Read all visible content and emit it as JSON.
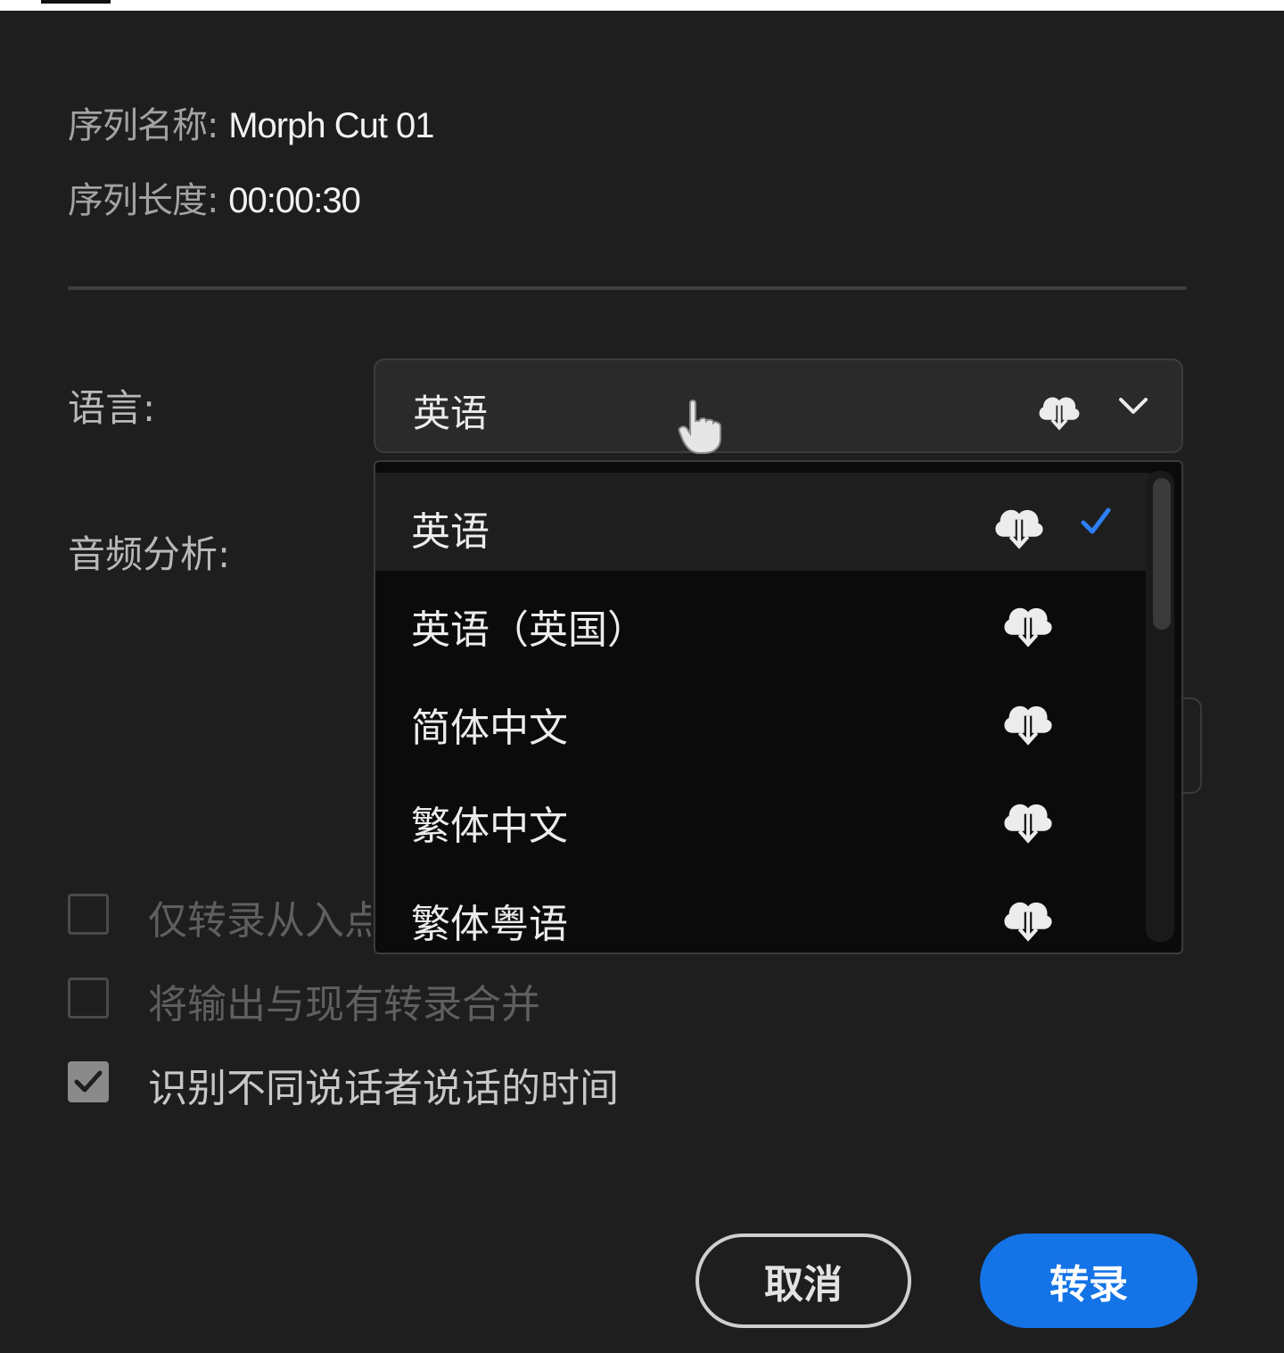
{
  "sequence": {
    "name_label": "序列名称:",
    "name_value": "Morph Cut 01",
    "length_label": "序列长度:",
    "length_value": "00:00:30"
  },
  "language": {
    "label": "语言:",
    "selected": "英语",
    "options": [
      {
        "label": "英语",
        "selected": true,
        "icon": "cloud-download-icon"
      },
      {
        "label": "英语（英国）",
        "selected": false,
        "icon": "cloud-download-icon"
      },
      {
        "label": "简体中文",
        "selected": false,
        "icon": "cloud-download-icon"
      },
      {
        "label": "繁体中文",
        "selected": false,
        "icon": "cloud-download-icon"
      },
      {
        "label": "繁体粤语",
        "selected": false,
        "icon": "cloud-download-icon"
      }
    ]
  },
  "audio_analysis": {
    "label": "音频分析:"
  },
  "checkboxes": [
    {
      "label": "仅转录从入点",
      "checked": false,
      "enabled": false
    },
    {
      "label": "将输出与现有转录合并",
      "checked": false,
      "enabled": false
    },
    {
      "label": "识别不同说话者说话的时间",
      "checked": true,
      "enabled": true
    }
  ],
  "buttons": {
    "cancel": "取消",
    "transcribe": "转录"
  },
  "colors": {
    "background": "#1e1e1e",
    "accent": "#1473e6",
    "check": "#2d7ff9"
  }
}
